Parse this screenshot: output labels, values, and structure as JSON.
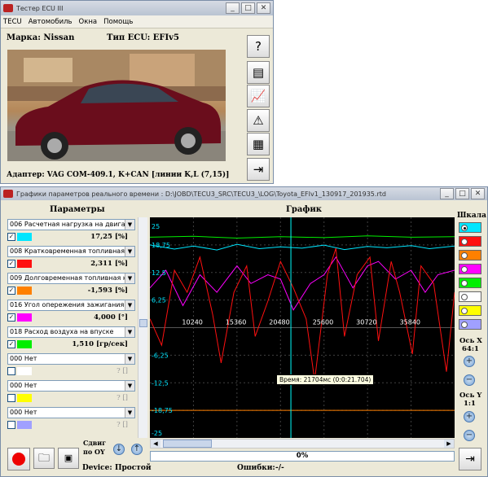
{
  "app": {
    "title": "Тестер ECU III",
    "menu": [
      "ТECU",
      "Автомобиль",
      "Окна",
      "Помощь"
    ],
    "make_label": "Марка: Nissan",
    "ecu_type_label": "Тип ECU:  EFIv5",
    "adapter_label": "Адаптер: VAG COM-409.1, K+CAN [линии K,L (7,15)]",
    "window_controls": {
      "min": "_",
      "max": "□",
      "close": "✕"
    }
  },
  "graph_window": {
    "title": "Графики параметров реального времени : D:\\JOBD\\TECU3_SRC\\TECU3_\\LOG\\Toyota_EFIv1_130917_201935.rtd",
    "params_header": "Параметры",
    "graph_header": "График",
    "scale_header": "Шкала",
    "axis_x_label": "Ось X",
    "axis_x_zoom": "64:1",
    "axis_y_label": "Ось Y",
    "axis_y_zoom": "1:1",
    "shift_label": "Сдвиг по OY",
    "device_label": "Device:",
    "device_value": "Простой",
    "errors_label": "Ошибки:",
    "errors_value": "-/-",
    "progress_text": "0%",
    "tooltip": "Время: 21704мс (0:0:21.704)",
    "params": [
      {
        "name": "006 Расчетная нагрузка на двигате",
        "value": "17,25 [%]",
        "color": "#00e6ff",
        "checked": true
      },
      {
        "name": "008 Кратковременная топливная ко",
        "value": "2,311 [%]",
        "color": "#ff1010",
        "checked": true
      },
      {
        "name": "009 Долговременная топливная кор",
        "value": "-1,593 [%]",
        "color": "#ff8000",
        "checked": true
      },
      {
        "name": "016 Угол опережения зажигания",
        "value": "4,000 [°]",
        "color": "#ff00ff",
        "checked": true
      },
      {
        "name": "018 Расход воздуха на впуске",
        "value": "1,510 [гр/сек]",
        "color": "#00ee00",
        "checked": true
      },
      {
        "name": "000 Нет",
        "value": "? []",
        "color": "#ffffff",
        "checked": false
      },
      {
        "name": "000 Нет",
        "value": "? []",
        "color": "#ffff00",
        "checked": false
      },
      {
        "name": "000 Нет",
        "value": "? []",
        "color": "#a0a0ff",
        "checked": false
      }
    ],
    "scale_colors": [
      "#00e6ff",
      "#ff1010",
      "#ff8000",
      "#ff00ff",
      "#00ee00",
      "#ffffff",
      "#ffff00",
      "#a0a0ff"
    ],
    "y_ticks": [
      "25",
      "18,75",
      "12,5",
      "6,25",
      "-6,25",
      "-12,5",
      "-18,75",
      "-25"
    ],
    "x_ticks": [
      "10240",
      "15360",
      "20480",
      "25600",
      "30720",
      "35840"
    ]
  },
  "chart_data": {
    "type": "line",
    "x_ticks": [
      10240,
      15360,
      20480,
      25600,
      30720,
      35840
    ],
    "ylim": [
      -25,
      25
    ],
    "xlim": [
      5120,
      40960
    ],
    "cursor_x": 21704,
    "grid": true,
    "series": [
      {
        "color": "#00ee00",
        "values_x": [
          5120,
          10240,
          15360,
          20480,
          25600,
          30720,
          35840,
          40960
        ],
        "values_y": [
          20.5,
          20.7,
          20.3,
          20.6,
          20.4,
          20.8,
          20.5,
          20.6
        ]
      },
      {
        "color": "#00e6ff",
        "values_x": [
          5120,
          8000,
          10240,
          13000,
          15360,
          18000,
          20480,
          23000,
          25600,
          28000,
          30720,
          33000,
          35840,
          38000,
          40960
        ],
        "values_y": [
          18.75,
          17.8,
          18.5,
          17.6,
          18.9,
          17.9,
          18.3,
          18.0,
          18.7,
          17.7,
          18.4,
          18.1,
          18.6,
          17.9,
          18.5
        ]
      },
      {
        "color": "#ff00ff",
        "values_x": [
          5120,
          7000,
          9000,
          11000,
          13000,
          15360,
          17000,
          19000,
          20480,
          22000,
          24000,
          25600,
          27000,
          29000,
          30720,
          32000,
          34000,
          35840,
          37500,
          39000,
          40960
        ],
        "values_y": [
          9,
          13,
          5,
          12,
          8,
          14,
          10,
          12,
          11,
          4,
          10,
          12,
          16,
          9,
          14,
          15,
          11,
          13,
          8,
          12,
          13
        ]
      },
      {
        "color": "#ff1010",
        "values_x": [
          5120,
          6500,
          8000,
          9500,
          11000,
          12500,
          13500,
          15000,
          16500,
          17500,
          19000,
          20480,
          22000,
          23500,
          24500,
          26000,
          27000,
          28000,
          29500,
          31000,
          32000,
          33500,
          34500,
          36000,
          37000,
          38500,
          40000,
          40960
        ],
        "values_y": [
          2,
          -4,
          13,
          8,
          16,
          3,
          -8,
          8,
          14,
          -2,
          6,
          15,
          9,
          2,
          -12,
          12,
          18,
          -2,
          12,
          16,
          -3,
          15,
          8,
          -6,
          14,
          10,
          -10,
          8
        ]
      },
      {
        "color": "#ff8000",
        "values_x": [
          5120,
          40960
        ],
        "values_y": [
          -18.75,
          -18.75
        ]
      }
    ]
  }
}
